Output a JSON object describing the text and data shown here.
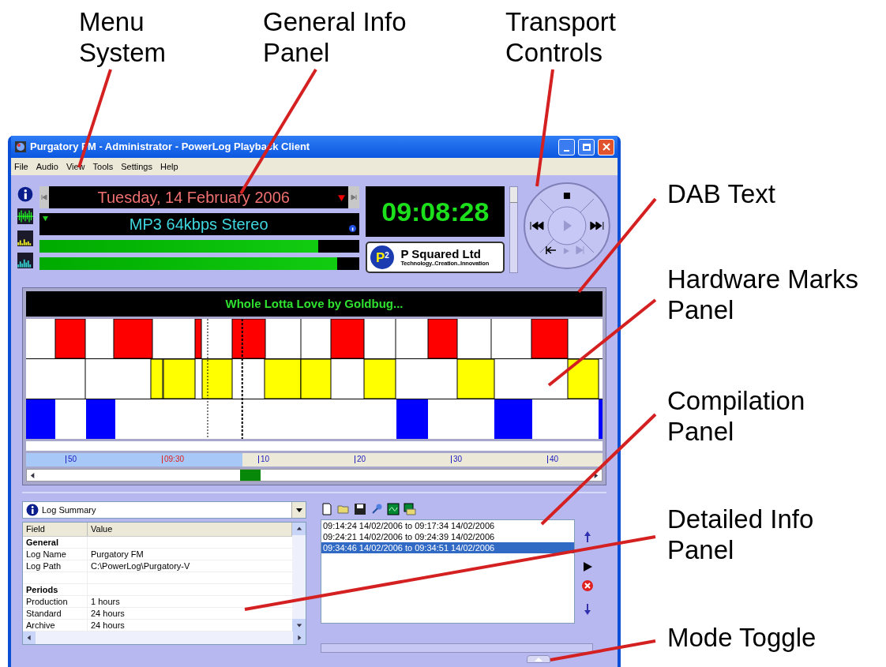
{
  "annotations": [
    {
      "lines": [
        "Menu",
        "System"
      ]
    },
    {
      "lines": [
        "General Info",
        "Panel"
      ]
    },
    {
      "lines": [
        "Transport",
        "Controls"
      ]
    },
    {
      "lines": [
        "DAB Text"
      ]
    },
    {
      "lines": [
        "Hardware Marks",
        "Panel"
      ]
    },
    {
      "lines": [
        "Compilation",
        "Panel"
      ]
    },
    {
      "lines": [
        "Detailed Info",
        "Panel"
      ]
    },
    {
      "lines": [
        "Mode Toggle"
      ]
    }
  ],
  "window": {
    "title": "Purgatory FM - Administrator - PowerLog Playback Client"
  },
  "menu": [
    "File",
    "Audio",
    "View",
    "Tools",
    "Settings",
    "Help"
  ],
  "date": "Tuesday, 14 February 2006",
  "format": "MP3 64kbps Stereo",
  "meters": [
    {
      "level": 0.87
    },
    {
      "level": 0.93
    }
  ],
  "clock": "09:08:28",
  "logo": {
    "mark": "P",
    "superscript": "2",
    "name": "P Squared Ltd",
    "tagline": "Technology..Creation..Innovation"
  },
  "dab_text": "Whole Lotta Love by Goldbug...",
  "ruler": {
    "level": 0.375,
    "labels": [
      {
        "text": "50",
        "kind": "minute"
      },
      {
        "text": "09:30",
        "kind": "hour"
      },
      {
        "text": "10",
        "kind": "minute"
      },
      {
        "text": "20",
        "kind": "minute"
      },
      {
        "text": "30",
        "kind": "minute"
      },
      {
        "text": "40",
        "kind": "minute"
      }
    ]
  },
  "info_panel": {
    "selector": "Log Summary",
    "columns": [
      "Field",
      "Value"
    ],
    "rows": [
      {
        "kind": "group",
        "field": "General"
      },
      {
        "kind": "item",
        "field": "Log Name",
        "value": "Purgatory FM"
      },
      {
        "kind": "item",
        "field": "Log Path",
        "value": "C:\\PowerLog\\Purgatory-V"
      },
      {
        "kind": "blank"
      },
      {
        "kind": "group",
        "field": "Periods"
      },
      {
        "kind": "item",
        "field": "Production",
        "value": "1 hours"
      },
      {
        "kind": "item",
        "field": "Standard",
        "value": "24 hours"
      },
      {
        "kind": "item",
        "field": "Archive",
        "value": "24 hours"
      }
    ]
  },
  "compilation": {
    "items": [
      {
        "text": "09:14:24 14/02/2006 to 09:17:34 14/02/2006",
        "selected": false
      },
      {
        "text": "09:24:21 14/02/2006 to 09:24:39 14/02/2006",
        "selected": false
      },
      {
        "text": "09:34:46 14/02/2006 to 09:34:51 14/02/2006",
        "selected": true
      }
    ]
  }
}
